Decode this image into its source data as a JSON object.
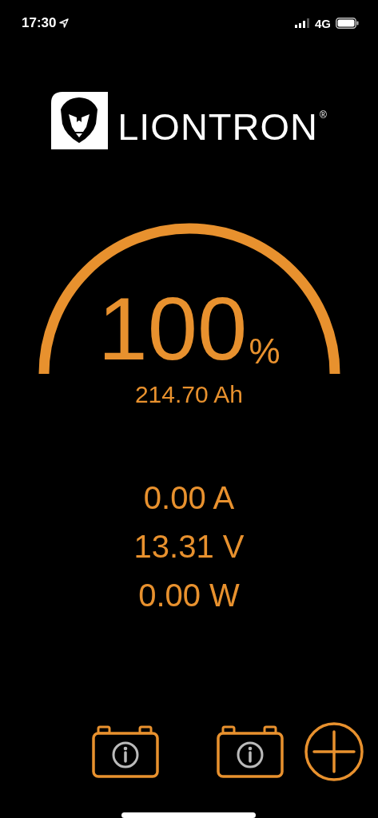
{
  "status_bar": {
    "time": "17:30",
    "network": "4G"
  },
  "logo": {
    "brand": "LIONTRON",
    "mark": "®"
  },
  "gauge": {
    "percent": "100",
    "unit": "%",
    "capacity": "214.70 Ah"
  },
  "readings": [
    {
      "value": "0.00 A"
    },
    {
      "value": "13.31 V"
    },
    {
      "value": "0.00 W"
    }
  ],
  "bottom_bar": {
    "buttons": [
      {
        "kind": "battery-info"
      },
      {
        "kind": "battery-info"
      },
      {
        "kind": "add"
      }
    ]
  }
}
